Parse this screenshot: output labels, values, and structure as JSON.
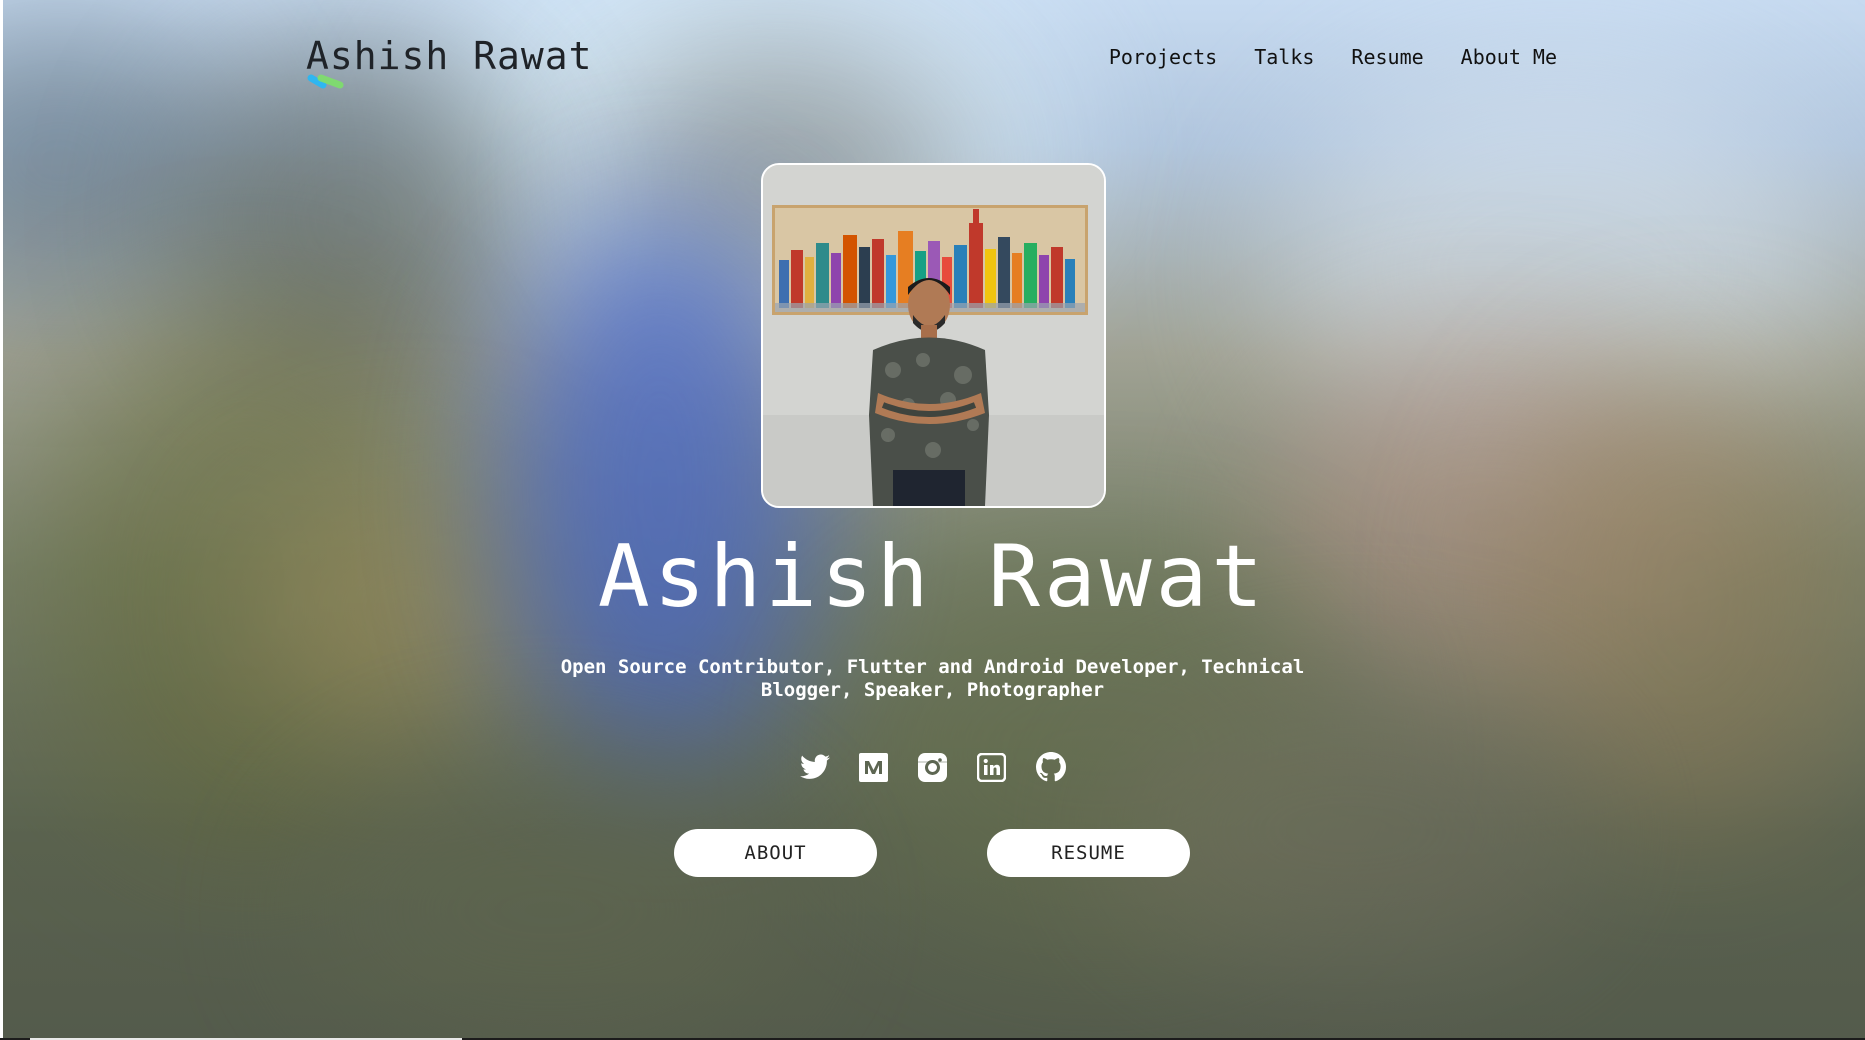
{
  "header": {
    "brand": "Ashish Rawat",
    "nav": [
      {
        "label": "Porojects"
      },
      {
        "label": "Talks"
      },
      {
        "label": "Resume"
      },
      {
        "label": "About Me"
      }
    ]
  },
  "hero": {
    "name": "Ashish Rawat",
    "tagline": "Open Source Contributor, Flutter and Android Developer, Technical Blogger, Speaker, Photographer",
    "socials": [
      {
        "icon": "twitter-icon"
      },
      {
        "icon": "medium-icon"
      },
      {
        "icon": "instagram-icon"
      },
      {
        "icon": "linkedin-icon"
      },
      {
        "icon": "github-icon"
      }
    ],
    "about_button": "ABOUT",
    "resume_button": "RESUME"
  },
  "colors": {
    "text_dark": "#1f2328",
    "white": "#ffffff",
    "brand_mark_blue": "#2fb6f0",
    "brand_mark_green": "#7ee06a"
  }
}
